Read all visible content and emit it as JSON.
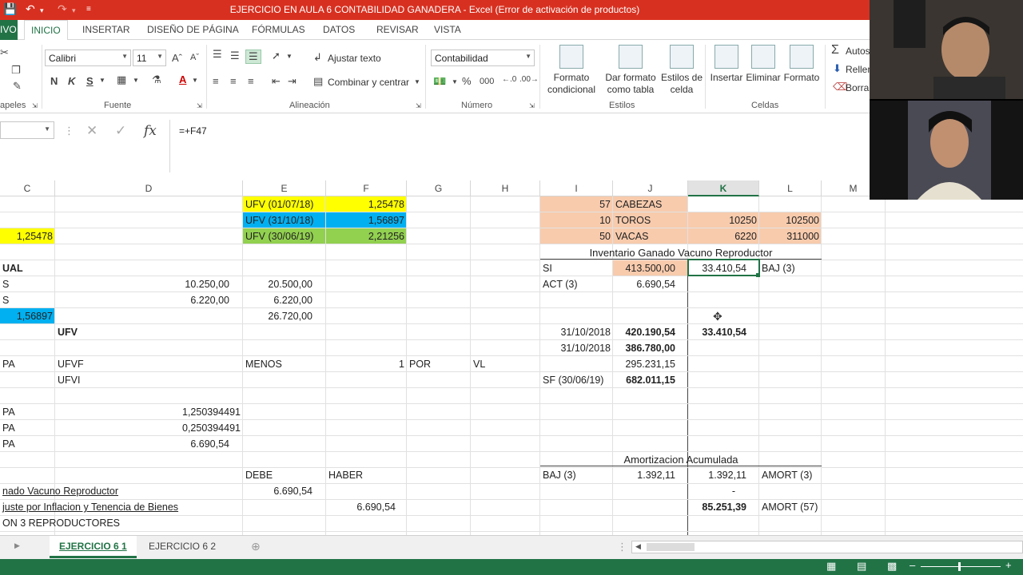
{
  "window": {
    "title": "EJERCICIO EN AULA 6 CONTABILIDAD GANADERA -  Excel (Error de activación de productos)"
  },
  "tabs": {
    "file": "IVO",
    "home": "INICIO",
    "insert": "INSERTAR",
    "layout": "DISEÑO DE PÁGINA",
    "formulas": "FÓRMULAS",
    "data": "DATOS",
    "review": "REVISAR",
    "view": "VISTA"
  },
  "ribbon": {
    "clipboard_label": "apeles",
    "font_name": "Calibri",
    "font_size": "11",
    "font_label": "Fuente",
    "bold": "N",
    "italic": "K",
    "underline": "S",
    "wrap_text": "Ajustar texto",
    "merge_center": "Combinar y centrar",
    "alignment_label": "Alineación",
    "number_format": "Contabilidad",
    "number_label": "Número",
    "percent": "%",
    "thousands": "000",
    "cond_format": "Formato\ncondicional",
    "format_table": "Dar formato\ncomo tabla",
    "cell_styles": "Estilos de\ncelda",
    "styles_label": "Estilos",
    "insert": "Insertar",
    "delete": "Eliminar",
    "format": "Formato",
    "cells_label": "Celdas",
    "autosum": "Autos",
    "fill": "Rellen",
    "clear": "Borra"
  },
  "formula_bar": {
    "content": "=+F47"
  },
  "columns": [
    "C",
    "D",
    "E",
    "F",
    "G",
    "H",
    "I",
    "J",
    "K",
    "L",
    "M"
  ],
  "selected_column": "K",
  "cells": {
    "E1": "UFV (01/07/18)",
    "F1": "1,25478",
    "I1": "57",
    "J1": "CABEZAS",
    "E2": "UFV (31/10/18)",
    "F2": "1,56897",
    "I2": "10",
    "J2": "TOROS",
    "K2": "10250",
    "L2": "102500",
    "C3": "1,25478",
    "E3": "UFV (30/06/19)",
    "F3": "2,21256",
    "I3": "50",
    "J3": "VACAS",
    "K3": "6220",
    "L3": "311000",
    "I4": "Inventario Ganado Vacuno Reproductor",
    "C5": "UAL",
    "I5": "SI",
    "J5": "413.500,00",
    "K5": "33.410,54",
    "L5": "BAJ (3)",
    "C6": "S",
    "D6": "10.250,00",
    "E6": "20.500,00",
    "I6": "ACT (3)",
    "J6": "6.690,54",
    "C7": "S",
    "D7": "6.220,00",
    "E7": "6.220,00",
    "C8": "1,56897",
    "E8": "26.720,00",
    "D9": "UFV",
    "I9": "31/10/2018",
    "J9": "420.190,54",
    "K9": "33.410,54",
    "I10": "31/10/2018",
    "J10": "386.780,00",
    "C11": "PA",
    "D11": "UFVF",
    "E11": "MENOS",
    "F11": "1",
    "G11": "POR",
    "H11": "VL",
    "J11": "295.231,15",
    "D12": "UFVI",
    "I12": "SF (30/06/19)",
    "J12": "682.011,15",
    "C14": "PA",
    "D14": "1,250394491",
    "C15": "PA",
    "D15": "0,250394491",
    "C16": "PA",
    "D16": "6.690,54",
    "I17": "Amortizacion Acumulada",
    "E18": "DEBE",
    "F18": "HABER",
    "I18": "BAJ (3)",
    "J18": "1.392,11",
    "K18": "1.392,11",
    "L18": "AMORT (3)",
    "C19": "nado Vacuno Reproductor",
    "E19": "6.690,54",
    "K19": "-",
    "C20": "juste por Inflacion y Tenencia de Bienes",
    "F20": "6.690,54",
    "K20": "85.251,39",
    "L20": "AMORT (57)",
    "C21": "ON 3 REPRODUCTORES"
  },
  "sheets": [
    "EJERCICIO 6  1",
    "EJERCICIO 6 2"
  ],
  "colors": {
    "excel_green": "#217346",
    "yellow": "#ffff00",
    "blue": "#00b0f0",
    "green": "#92d050",
    "salmon": "#f8cbad",
    "titlebar": "#d83020"
  }
}
